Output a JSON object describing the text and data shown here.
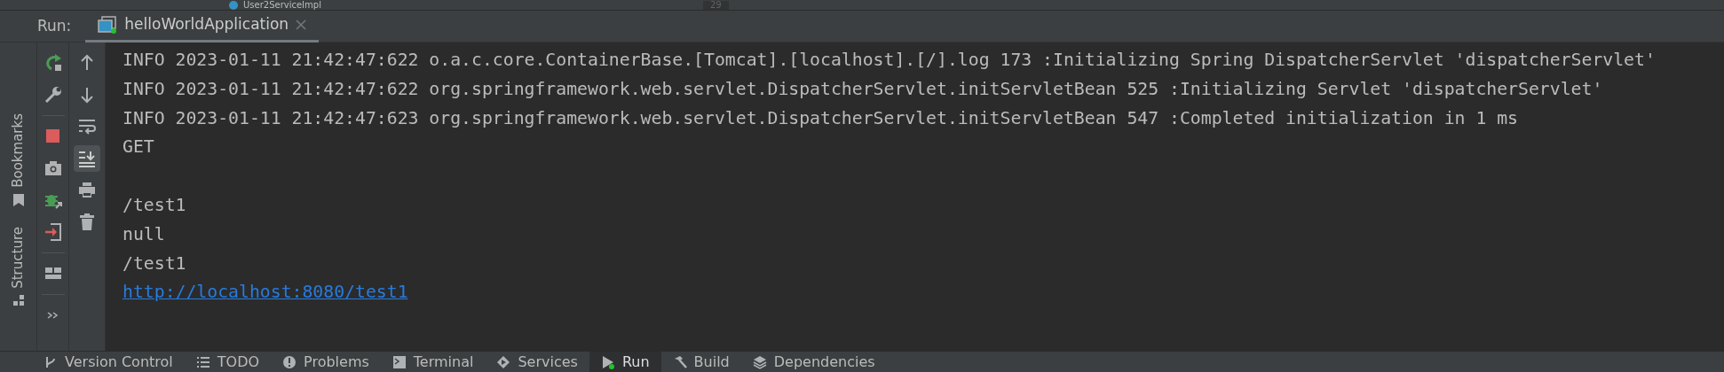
{
  "editor_strip": {
    "file": "User2ServiceImpl",
    "line_number": "29"
  },
  "run_panel": {
    "label": "Run:",
    "tabs": [
      {
        "label": "helloWorldApplication",
        "selected": true,
        "running": true
      }
    ]
  },
  "side_tabs": [
    {
      "label": "Bookmarks",
      "kind": "bookmark"
    },
    {
      "label": "Structure",
      "kind": "structure"
    }
  ],
  "run_toolbar": [
    {
      "kind": "rerun"
    },
    {
      "kind": "wrench"
    },
    {
      "kind": "separator"
    },
    {
      "kind": "stop"
    },
    {
      "kind": "camera"
    },
    {
      "kind": "bug"
    },
    {
      "kind": "exit"
    },
    {
      "kind": "separator"
    },
    {
      "kind": "layout"
    },
    {
      "kind": "separator"
    },
    {
      "kind": "more"
    }
  ],
  "console_toolbar": [
    {
      "kind": "up",
      "selected": false
    },
    {
      "kind": "down",
      "selected": false
    },
    {
      "kind": "wrap",
      "selected": false
    },
    {
      "kind": "scroll-end",
      "selected": true
    },
    {
      "kind": "print",
      "selected": false
    },
    {
      "kind": "trash",
      "selected": false
    }
  ],
  "console": {
    "lines": [
      {
        "kind": "text",
        "text": "INFO 2023-01-11 21:42:47:622 o.a.c.core.ContainerBase.[Tomcat].[localhost].[/].log 173 :Initializing Spring DispatcherServlet 'dispatcherServlet'"
      },
      {
        "kind": "text",
        "text": "INFO 2023-01-11 21:42:47:622 org.springframework.web.servlet.DispatcherServlet.initServletBean 525 :Initializing Servlet 'dispatcherServlet'"
      },
      {
        "kind": "text",
        "text": "INFO 2023-01-11 21:42:47:623 org.springframework.web.servlet.DispatcherServlet.initServletBean 547 :Completed initialization in 1 ms"
      },
      {
        "kind": "text",
        "text": "GET"
      },
      {
        "kind": "blank"
      },
      {
        "kind": "text",
        "text": "/test1"
      },
      {
        "kind": "text",
        "text": "null"
      },
      {
        "kind": "text",
        "text": "/test1"
      },
      {
        "kind": "link",
        "text": "http://localhost:8080/test1"
      }
    ]
  },
  "bottom_tabs": [
    {
      "label": "Version Control",
      "kind": "branch",
      "selected": false
    },
    {
      "label": "TODO",
      "kind": "list",
      "selected": false
    },
    {
      "label": "Problems",
      "kind": "alert",
      "selected": false
    },
    {
      "label": "Terminal",
      "kind": "terminal",
      "selected": false
    },
    {
      "label": "Services",
      "kind": "services",
      "selected": false
    },
    {
      "label": "Run",
      "kind": "run",
      "selected": true
    },
    {
      "label": "Build",
      "kind": "hammer",
      "selected": false
    },
    {
      "label": "Dependencies",
      "kind": "layers",
      "selected": false
    }
  ]
}
